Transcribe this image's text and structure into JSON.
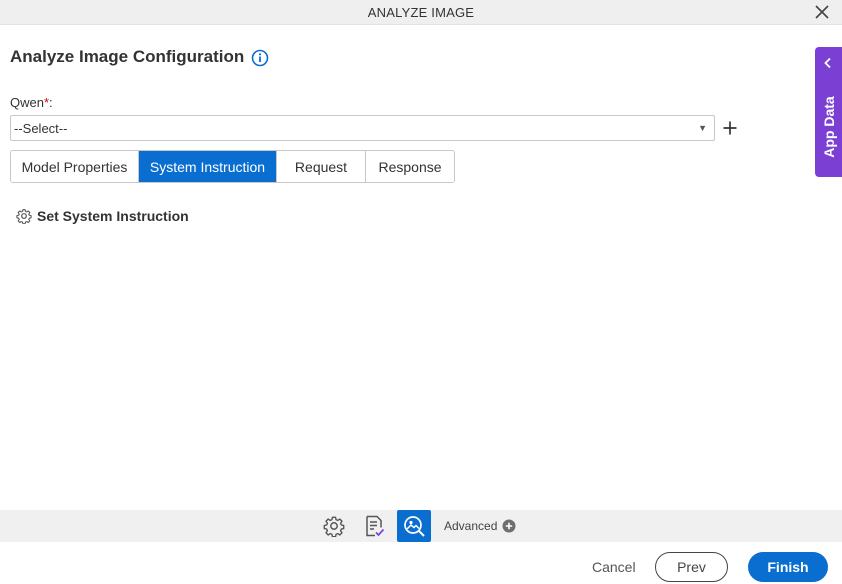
{
  "window": {
    "title": "ANALYZE IMAGE"
  },
  "page": {
    "heading": "Analyze Image Configuration"
  },
  "qwen_field": {
    "label": "Qwen",
    "required_mark": "*",
    "colon": ":",
    "value": "--Select--"
  },
  "tabs": [
    {
      "label": "Model Properties",
      "active": false
    },
    {
      "label": "System Instruction",
      "active": true
    },
    {
      "label": "Request",
      "active": false
    },
    {
      "label": "Response",
      "active": false
    }
  ],
  "content": {
    "set_instruction_label": "Set System Instruction"
  },
  "side_panel": {
    "label": "App Data"
  },
  "toolbar": {
    "icons": [
      "settings-icon",
      "document-check-icon",
      "image-analyze-icon"
    ],
    "advanced_label": "Advanced"
  },
  "footer": {
    "cancel_label": "Cancel",
    "prev_label": "Prev",
    "finish_label": "Finish"
  },
  "colors": {
    "accent": "#0a6ed1",
    "side_panel": "#7b3fd4",
    "required": "#d0021b"
  }
}
